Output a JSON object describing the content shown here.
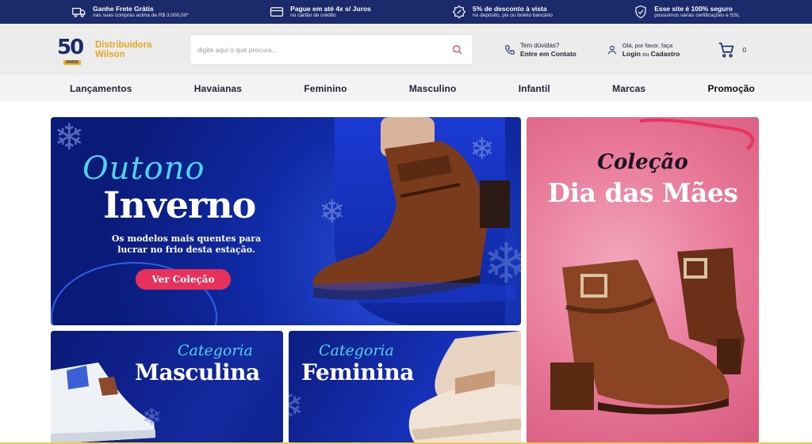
{
  "topbar": {
    "items": [
      {
        "icon": "truck-icon",
        "title": "Ganhe Frete Grátis",
        "sub": "nas suas compras acima de R$ 3.000,00*"
      },
      {
        "icon": "credit-card-icon",
        "title": "Pague em até 4x s/ Juros",
        "sub": "no cartão de crédito"
      },
      {
        "icon": "discount-tag-icon",
        "title": "5% de desconto à vista",
        "sub": "no depósito, pix ou boleto bancário"
      },
      {
        "icon": "shield-check-icon",
        "title": "Esse site é 100% seguro",
        "sub": "possuimos varias certificações e SSL"
      }
    ],
    "bg_color": "#1b2a6b"
  },
  "header": {
    "logo": {
      "number": "50",
      "anos": "ANOS",
      "line1": "Distribuidora",
      "line2": "Wilson"
    },
    "search": {
      "placeholder": "digite aqui o que procura..."
    },
    "help": {
      "line1": "Tem dúvidas?",
      "line2": "Entre em Contato"
    },
    "account": {
      "line1": "Olá, por favor, faça",
      "login": "Login",
      "or": "ou",
      "signup": "Cadastro"
    },
    "cart": {
      "count": "0"
    },
    "accent_color": "#e3a623"
  },
  "nav": {
    "items": [
      "Lançamentos",
      "Havaianas",
      "Feminino",
      "Masculino",
      "Infantil",
      "Marcas",
      "Promoção"
    ]
  },
  "banners": {
    "main": {
      "script": "Outono",
      "title": "Inverno",
      "subtitle": "Os modelos mais quentes para lucrar no frio desta estação.",
      "button": "Ver Coleção"
    },
    "dia_maes": {
      "script": "Coleção",
      "title": "Dia das Mães"
    },
    "masculina": {
      "script": "Categoria",
      "title": "Masculina"
    },
    "feminina": {
      "script": "Categoria",
      "title": "Feminina"
    },
    "button_color": "#e6315b",
    "script_color": "#4fd2ea"
  }
}
